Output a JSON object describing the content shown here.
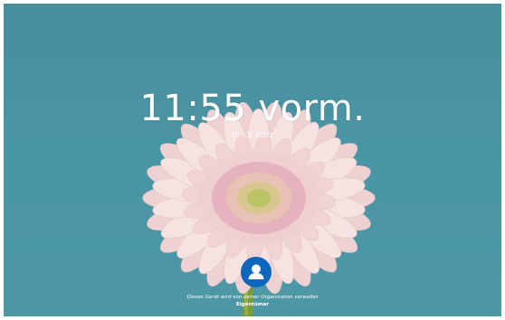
{
  "lock_screen": {
    "time": "11:55 vorm.",
    "date": "Di., 3. März",
    "org_notice": "Dieses Gerät wird von deiner Organisation verwaltet",
    "user_name": "Eigentümer",
    "user_avatar_icon": "person-icon",
    "wallpaper_icon": "flower-icon"
  },
  "colors": {
    "background": "#4a95a4",
    "avatar_circle": "#0f67bd",
    "petal": "#f3dcdc",
    "petal_shadow": "#e6c4c6",
    "center_ring": "#e5b3bd",
    "center": "#c9cc7a",
    "stem": "#7a9a3a"
  }
}
